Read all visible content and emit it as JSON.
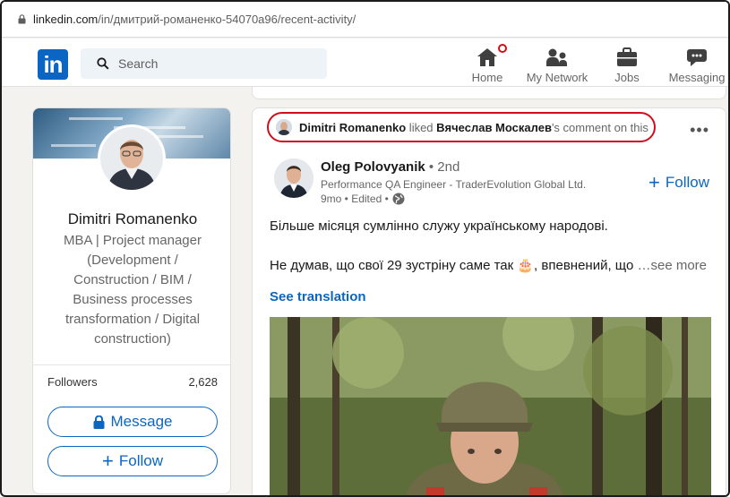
{
  "browser": {
    "url_host": "linkedin.com",
    "url_path": "/in/дмитрий-романенко-54070a96/recent-activity/"
  },
  "nav": {
    "logo": "in",
    "search_placeholder": "Search",
    "items": [
      {
        "label": "Home",
        "icon": "home-icon"
      },
      {
        "label": "My Network",
        "icon": "network-icon"
      },
      {
        "label": "Jobs",
        "icon": "briefcase-icon"
      },
      {
        "label": "Messaging",
        "icon": "messaging-icon"
      }
    ]
  },
  "profile": {
    "name": "Dimitri Romanenko",
    "headline": "MBA | Project manager (Development / Construction / BIM / Business processes transformation / Digital construction)",
    "followers_label": "Followers",
    "followers_count": "2,628",
    "message_label": "Message",
    "follow_label": "Follow"
  },
  "activity": {
    "actor": "Dimitri Romanenko",
    "verb": " liked ",
    "target": "Вячеслав Москалев",
    "suffix": "'s comment on this",
    "more": "•••"
  },
  "post": {
    "author_name": "Oleg Polovyanik",
    "author_degree": " • 2nd",
    "author_title": "Performance QA Engineer - TraderEvolution Global Ltd.",
    "meta": "9mo • Edited •",
    "follow_label": "Follow",
    "line1": "Більше місяця сумлінно служу українському народові.",
    "line2": "Не думав, що свої 29 зустріну саме так 🎂, впевнений, що",
    "see_more": "…see more",
    "see_translation": "See translation"
  },
  "colors": {
    "brand": "#0a66c2",
    "highlight": "#d10c1c",
    "badge": "#cc1016"
  }
}
